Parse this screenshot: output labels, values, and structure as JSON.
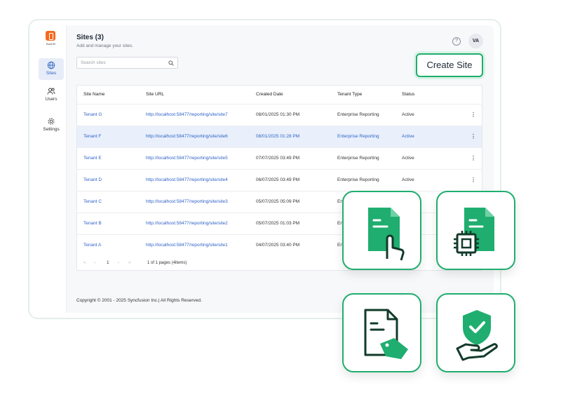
{
  "sidebar": {
    "logo_text": "Bold BI",
    "items": [
      {
        "label": "Sites",
        "icon": "globe-icon",
        "active": true
      },
      {
        "label": "Users",
        "icon": "users-icon"
      },
      {
        "label": "Settings",
        "icon": "gear-icon"
      }
    ]
  },
  "header": {
    "title": "Sites (3)",
    "subtitle": "Add and manage your sites.",
    "avatar": "VA",
    "help": "?"
  },
  "search": {
    "placeholder": "Search sites"
  },
  "create_button": "Create Site",
  "table": {
    "columns": [
      "Site Name",
      "Site URL",
      "Created Date",
      "Tenant Type",
      "Status"
    ],
    "rows": [
      {
        "name": "Tenant G",
        "url": "http://localhost:58477/reporting/site/site7",
        "date": "08/01/2025 01:30 PM",
        "type": "Enterprise Reporting",
        "status": "Active",
        "menu": "⋮"
      },
      {
        "name": "Tenant F",
        "url": "http://localhost:58477/reporting/site/site6",
        "date": "08/01/2025 01:28 PM",
        "type": "Enterprise Reporting",
        "status": "Active",
        "menu": "⋮"
      },
      {
        "name": "Tenant E",
        "url": "http://localhost:58477/reporting/site/site5",
        "date": "07/07/2025 03:49 PM",
        "type": "Enterprise Reporting",
        "status": "Active",
        "menu": "⋮"
      },
      {
        "name": "Tenant D",
        "url": "http://localhost:58477/reporting/site/site4",
        "date": "06/07/2025 03:49 PM",
        "type": "Enterprise Reporting",
        "status": "Active",
        "menu": "⋮"
      },
      {
        "name": "Tenant C",
        "url": "http://localhost:58477/reporting/site/site3",
        "date": "05/07/2025 05:09 PM",
        "type": "En",
        "status": "",
        "menu": ""
      },
      {
        "name": "Tenant B",
        "url": "http://localhost:58477/reporting/site/site2",
        "date": "05/07/2025 01:03 PM",
        "type": "En",
        "status": "",
        "menu": ""
      },
      {
        "name": "Tenant A",
        "url": "http://localhost:58477/reporting/site/site1",
        "date": "04/07/2025 03:40 PM",
        "type": "En",
        "status": "",
        "menu": ""
      }
    ],
    "selected_row": 1
  },
  "pager": {
    "first": "«",
    "prev": "‹",
    "page": "1",
    "next": "›",
    "last": "»",
    "info": "1 of 1 pages (4items)"
  },
  "footer": "Copyright © 2001 - 2025 Syncfusion Inc.| All Rights Reserved.",
  "features": [
    {
      "icon": "document-touch-icon"
    },
    {
      "icon": "document-chip-icon"
    },
    {
      "icon": "document-tag-icon"
    },
    {
      "icon": "hand-shield-check-icon"
    }
  ],
  "colors": {
    "accent": "#1fae6f",
    "link": "#2f62c6",
    "logo": "#f56a1d",
    "selected": "#e9f0fb"
  }
}
